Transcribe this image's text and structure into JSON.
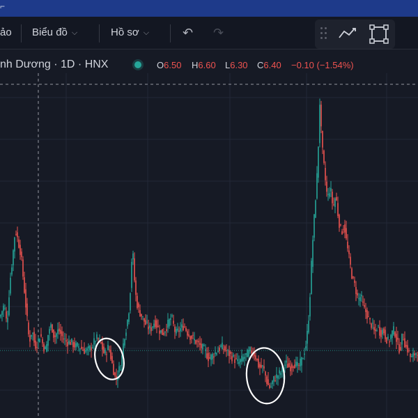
{
  "menu": {
    "cut_left": "ảo",
    "chart_label": "Biểu đồ",
    "profile_label": "Hồ sơ"
  },
  "icons": {
    "undo": "undo-icon",
    "redo": "redo-icon",
    "trend": "trend-line-icon",
    "rect": "rectangle-select-icon"
  },
  "legend": {
    "symbol": "nh Dương · 1D · HNX",
    "o_key": "O",
    "o_val": "6.50",
    "h_key": "H",
    "h_val": "6.60",
    "l_key": "L",
    "l_val": "6.30",
    "c_key": "C",
    "c_val": "6.40",
    "change": "−0.10 (−1.54%)"
  },
  "colors": {
    "up": "#26a69a",
    "down": "#ef5350",
    "background": "#161a25",
    "grid": "#232838",
    "annotation": "#ffffff"
  },
  "chart_data": {
    "type": "candlestick",
    "interval": "1D",
    "exchange": "HNX",
    "ylim": [
      5.0,
      13.0
    ],
    "grid": true,
    "last_close": 6.4,
    "series": [
      {
        "close_path": [
          [
            0,
            7.2
          ],
          [
            6,
            7.5
          ],
          [
            10,
            7.0
          ],
          [
            14,
            8.0
          ],
          [
            18,
            8.6
          ],
          [
            22,
            9.3
          ],
          [
            26,
            9.0
          ],
          [
            30,
            8.7
          ],
          [
            34,
            8.0
          ],
          [
            38,
            7.3
          ],
          [
            42,
            6.6
          ],
          [
            46,
            6.9
          ],
          [
            50,
            6.5
          ],
          [
            54,
            6.6
          ],
          [
            58,
            6.8
          ],
          [
            62,
            6.5
          ],
          [
            66,
            6.4
          ],
          [
            70,
            6.9
          ],
          [
            74,
            7.0
          ],
          [
            78,
            6.7
          ],
          [
            84,
            6.9
          ],
          [
            90,
            6.7
          ],
          [
            96,
            6.6
          ],
          [
            102,
            6.6
          ],
          [
            108,
            6.5
          ],
          [
            114,
            6.5
          ],
          [
            120,
            6.4
          ],
          [
            126,
            6.4
          ],
          [
            132,
            6.5
          ],
          [
            138,
            6.7
          ],
          [
            144,
            6.6
          ],
          [
            150,
            6.3
          ],
          [
            156,
            6.5
          ],
          [
            162,
            6.0
          ],
          [
            166,
            5.7
          ],
          [
            170,
            5.9
          ],
          [
            174,
            6.1
          ],
          [
            178,
            6.7
          ],
          [
            182,
            7.0
          ],
          [
            186,
            7.5
          ],
          [
            190,
            8.9
          ],
          [
            194,
            7.8
          ],
          [
            198,
            7.4
          ],
          [
            204,
            7.2
          ],
          [
            210,
            7.0
          ],
          [
            216,
            6.9
          ],
          [
            222,
            7.1
          ],
          [
            228,
            6.9
          ],
          [
            234,
            6.8
          ],
          [
            240,
            7.0
          ],
          [
            246,
            7.2
          ],
          [
            252,
            6.8
          ],
          [
            258,
            6.9
          ],
          [
            264,
            7.0
          ],
          [
            270,
            6.8
          ],
          [
            276,
            6.7
          ],
          [
            282,
            6.6
          ],
          [
            288,
            6.5
          ],
          [
            294,
            6.4
          ],
          [
            300,
            6.2
          ],
          [
            306,
            6.3
          ],
          [
            312,
            6.4
          ],
          [
            318,
            6.5
          ],
          [
            324,
            6.4
          ],
          [
            330,
            6.3
          ],
          [
            336,
            6.2
          ],
          [
            342,
            6.1
          ],
          [
            348,
            6.2
          ],
          [
            354,
            6.3
          ],
          [
            360,
            6.4
          ],
          [
            366,
            6.3
          ],
          [
            372,
            6.0
          ],
          [
            378,
            6.0
          ],
          [
            384,
            5.6
          ],
          [
            388,
            5.5
          ],
          [
            392,
            5.7
          ],
          [
            398,
            5.8
          ],
          [
            404,
            5.9
          ],
          [
            410,
            6.1
          ],
          [
            416,
            6.0
          ],
          [
            422,
            6.1
          ],
          [
            428,
            6.0
          ],
          [
            434,
            6.2
          ],
          [
            440,
            6.6
          ],
          [
            444,
            7.4
          ],
          [
            448,
            8.8
          ],
          [
            452,
            9.8
          ],
          [
            456,
            10.8
          ],
          [
            459,
            12.3
          ],
          [
            462,
            11.3
          ],
          [
            466,
            10.6
          ],
          [
            470,
            10.0
          ],
          [
            474,
            10.3
          ],
          [
            478,
            9.8
          ],
          [
            482,
            10.1
          ],
          [
            486,
            9.5
          ],
          [
            490,
            9.2
          ],
          [
            494,
            9.4
          ],
          [
            498,
            8.9
          ],
          [
            502,
            8.5
          ],
          [
            506,
            8.1
          ],
          [
            510,
            7.9
          ],
          [
            514,
            7.6
          ],
          [
            518,
            7.7
          ],
          [
            522,
            7.4
          ],
          [
            526,
            7.3
          ],
          [
            530,
            7.1
          ],
          [
            534,
            7.0
          ],
          [
            538,
            6.8
          ],
          [
            542,
            7.0
          ],
          [
            546,
            6.8
          ],
          [
            550,
            6.9
          ],
          [
            554,
            6.7
          ],
          [
            558,
            6.6
          ],
          [
            562,
            6.8
          ],
          [
            566,
            6.9
          ],
          [
            570,
            6.6
          ],
          [
            574,
            6.4
          ],
          [
            578,
            6.8
          ],
          [
            582,
            6.5
          ],
          [
            586,
            6.4
          ],
          [
            590,
            6.2
          ],
          [
            594,
            6.3
          ],
          [
            600,
            6.4
          ]
        ]
      }
    ],
    "annotations": [
      {
        "type": "ellipse",
        "center": [
          157,
          6.2
        ],
        "radius": [
          20,
          30
        ],
        "rotate": -15
      },
      {
        "type": "ellipse",
        "center": [
          381,
          5.8
        ],
        "radius": [
          27,
          40
        ],
        "rotate": -5
      }
    ]
  }
}
